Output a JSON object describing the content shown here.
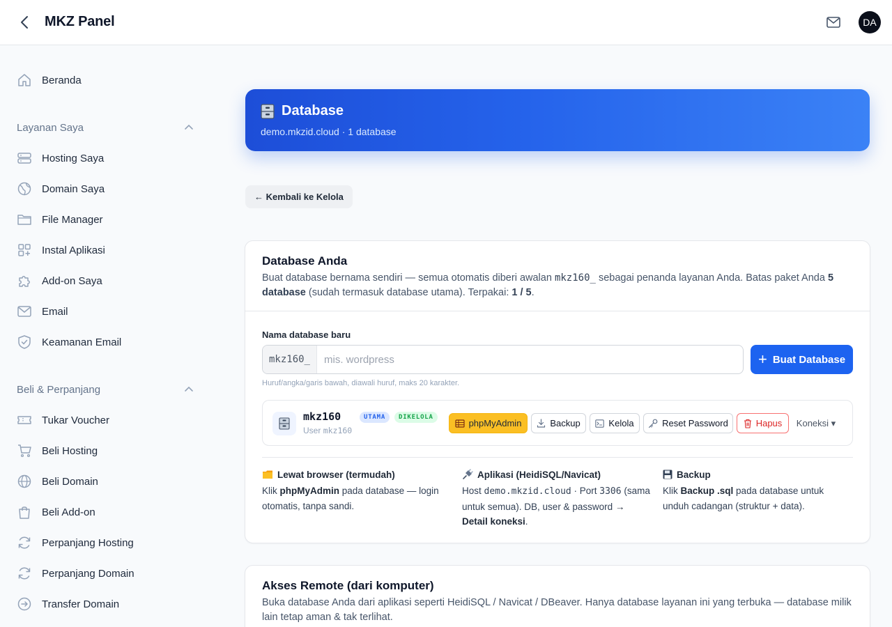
{
  "header": {
    "title": "MKZ Panel",
    "avatar_initials": "DA"
  },
  "sidebar": {
    "home": "Beranda",
    "section_services": "Layanan Saya",
    "services": [
      "Hosting Saya",
      "Domain Saya",
      "File Manager",
      "Instal Aplikasi",
      "Add-on Saya",
      "Email",
      "Keamanan Email"
    ],
    "section_buy": "Beli & Perpanjang",
    "buy": [
      "Tukar Voucher",
      "Beli Hosting",
      "Beli Domain",
      "Beli Add-on",
      "Perpanjang Hosting",
      "Perpanjang Domain",
      "Transfer Domain"
    ]
  },
  "hero": {
    "title": "Database",
    "subtitle": "demo.mkzid.cloud · 1 database"
  },
  "back_link": "← Kembali ke Kelola",
  "databases_card": {
    "title": "Database Anda",
    "desc_1": "Buat database bernama sendiri — semua otomatis diberi awalan ",
    "desc_prefix": "mkz160_",
    "desc_2": " sebagai penanda layanan Anda. Batas paket Anda ",
    "desc_limit": "5 database",
    "desc_3": " (sudah termasuk database utama). Terpakai: ",
    "desc_used": "1 / 5",
    "desc_4": ".",
    "field_label": "Nama database baru",
    "prefix": "mkz160_",
    "input_value": "",
    "input_placeholder": "mis. wordpress",
    "create_button": "Buat Database",
    "hint": "Huruf/angka/garis bawah, diawali huruf, maks 20 karakter.",
    "db_row": {
      "name": "mkz160",
      "badge_main": "UTAMA",
      "badge_managed": "DIKELOLA",
      "user_label": "User",
      "user": "mkz160",
      "actions": {
        "phpmyadmin": "phpMyAdmin",
        "backup": "Backup",
        "kelola": "Kelola",
        "reset_password": "Reset Password",
        "hapus": "Hapus",
        "koneksi": "Koneksi ▾"
      }
    },
    "tips": [
      {
        "title": "Lewat browser (termudah)",
        "b1": "Klik ",
        "b2": "phpMyAdmin",
        "b3": " pada database — login otomatis, tanpa sandi."
      },
      {
        "title": "Aplikasi (HeidiSQL/Navicat)",
        "b1": "Host ",
        "host": "demo.mkzid.cloud",
        "b2": " · Port ",
        "port": "3306",
        "b3": " (sama untuk semua). DB, user & password ",
        "b4": "→ Detail koneksi",
        "b5": "."
      },
      {
        "title": "Backup",
        "b1": "Klik ",
        "b2": "Backup .sql",
        "b3": " pada database untuk unduh cadangan (struktur + data)."
      }
    ]
  },
  "remote_card": {
    "title": "Akses Remote (dari komputer)",
    "desc": "Buka database Anda dari aplikasi seperti HeidiSQL / Navicat / DBeaver. Hanya database layanan ini yang terbuka — database milik lain tetap aman & tak terlihat."
  }
}
